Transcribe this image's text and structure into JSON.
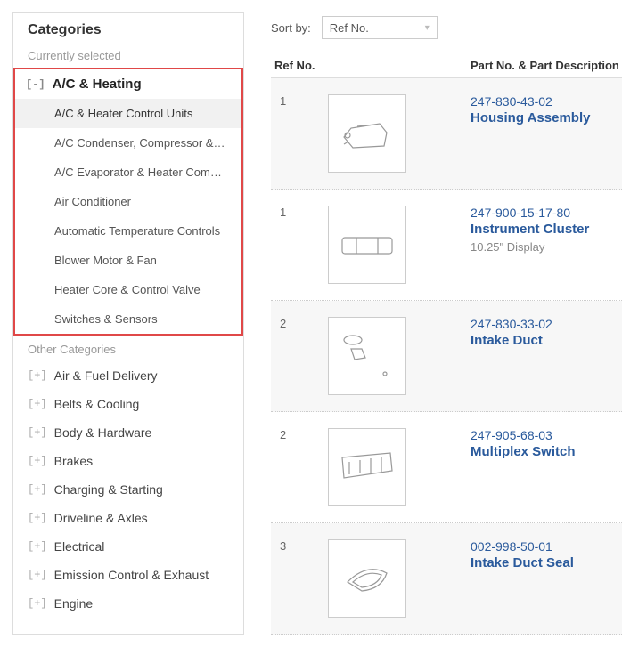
{
  "sidebar": {
    "title": "Categories",
    "selected_label": "Currently selected",
    "current_category": "A/C & Heating",
    "expand_collapse_icon": "[-]",
    "expand_icon": "[+]",
    "subcategories": [
      "A/C & Heater Control Units",
      "A/C Condenser, Compressor & Lines",
      "A/C Evaporator & Heater Compon…",
      "Air Conditioner",
      "Automatic Temperature Controls",
      "Blower Motor & Fan",
      "Heater Core & Control Valve",
      "Switches & Sensors"
    ],
    "other_label": "Other Categories",
    "other_categories": [
      "Air & Fuel Delivery",
      "Belts & Cooling",
      "Body & Hardware",
      "Brakes",
      "Charging & Starting",
      "Driveline & Axles",
      "Electrical",
      "Emission Control & Exhaust",
      "Engine"
    ]
  },
  "main": {
    "sort_label": "Sort by:",
    "sort_value": "Ref No.",
    "headers": {
      "ref": "Ref No.",
      "desc": "Part No. & Part Description"
    },
    "parts": [
      {
        "ref": "1",
        "part_no": "247-830-43-02",
        "name": "Housing Assembly",
        "note": ""
      },
      {
        "ref": "1",
        "part_no": "247-900-15-17-80",
        "name": "Instrument Cluster",
        "note": "10.25\" Display"
      },
      {
        "ref": "2",
        "part_no": "247-830-33-02",
        "name": "Intake Duct",
        "note": ""
      },
      {
        "ref": "2",
        "part_no": "247-905-68-03",
        "name": "Multiplex Switch",
        "note": ""
      },
      {
        "ref": "3",
        "part_no": "002-998-50-01",
        "name": "Intake Duct Seal",
        "note": ""
      }
    ]
  }
}
